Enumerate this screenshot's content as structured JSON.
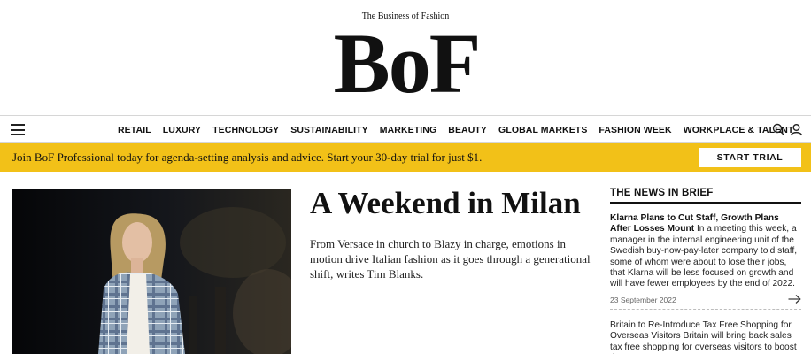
{
  "masthead": {
    "tagline": "The Business of Fashion",
    "logo_text": "BoF"
  },
  "nav": {
    "items": [
      {
        "label": "RETAIL"
      },
      {
        "label": "LUXURY"
      },
      {
        "label": "TECHNOLOGY"
      },
      {
        "label": "SUSTAINABILITY"
      },
      {
        "label": "MARKETING"
      },
      {
        "label": "BEAUTY"
      },
      {
        "label": "GLOBAL MARKETS"
      },
      {
        "label": "FASHION WEEK"
      },
      {
        "label": "WORKPLACE & TALENT"
      }
    ],
    "icons": [
      "menu-icon",
      "search-icon",
      "user-icon"
    ]
  },
  "promo": {
    "text": "Join BoF Professional today for agenda-setting analysis and advice. Start your 30-day trial for just $1.",
    "button_label": "START TRIAL",
    "background": "#f2c118"
  },
  "feature": {
    "headline": "A Weekend in Milan",
    "deck": "From Versace in church to Blazy in charge, emotions in motion drive Italian fashion as it goes through a generational shift, writes Tim Blanks."
  },
  "news_in_brief": {
    "title": "THE NEWS IN BRIEF",
    "items": [
      {
        "headline": "Klarna Plans to Cut Staff, Growth Plans After Losses Mount",
        "summary": "In a meeting this week, a manager in the internal engineering unit of the Swedish buy-now-pay-later company told staff, some of whom were about to lose their jobs, that Klarna will be less focused on growth and will have fewer employees by the end of 2022.",
        "date": "23 September 2022"
      },
      {
        "headline": "Britain to Re-Introduce Tax Free Shopping for Overseas Visitors",
        "summary": "Britain will bring back sales tax free shopping for overseas visitors to boost the"
      }
    ]
  }
}
